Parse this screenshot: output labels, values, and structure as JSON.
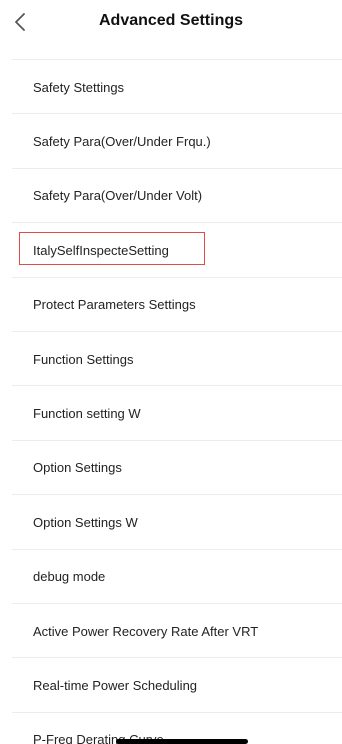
{
  "header": {
    "title": "Advanced Settings"
  },
  "menu": {
    "items": [
      {
        "label": "Safety Stettings"
      },
      {
        "label": "Safety Para(Over/Under Frqu.)"
      },
      {
        "label": "Safety Para(Over/Under Volt)"
      },
      {
        "label": "ItalySelfInspecteSetting",
        "highlighted": true
      },
      {
        "label": "Protect Parameters Settings"
      },
      {
        "label": "Function Settings"
      },
      {
        "label": "Function setting W"
      },
      {
        "label": "Option Settings"
      },
      {
        "label": "Option Settings W"
      },
      {
        "label": "debug mode"
      },
      {
        "label": "Active Power Recovery Rate After VRT"
      },
      {
        "label": "Real-time Power Scheduling"
      },
      {
        "label": "P-Freq Derating Curve"
      }
    ]
  },
  "colors": {
    "highlight_border": "#e34b4b",
    "divider": "#ececec"
  }
}
